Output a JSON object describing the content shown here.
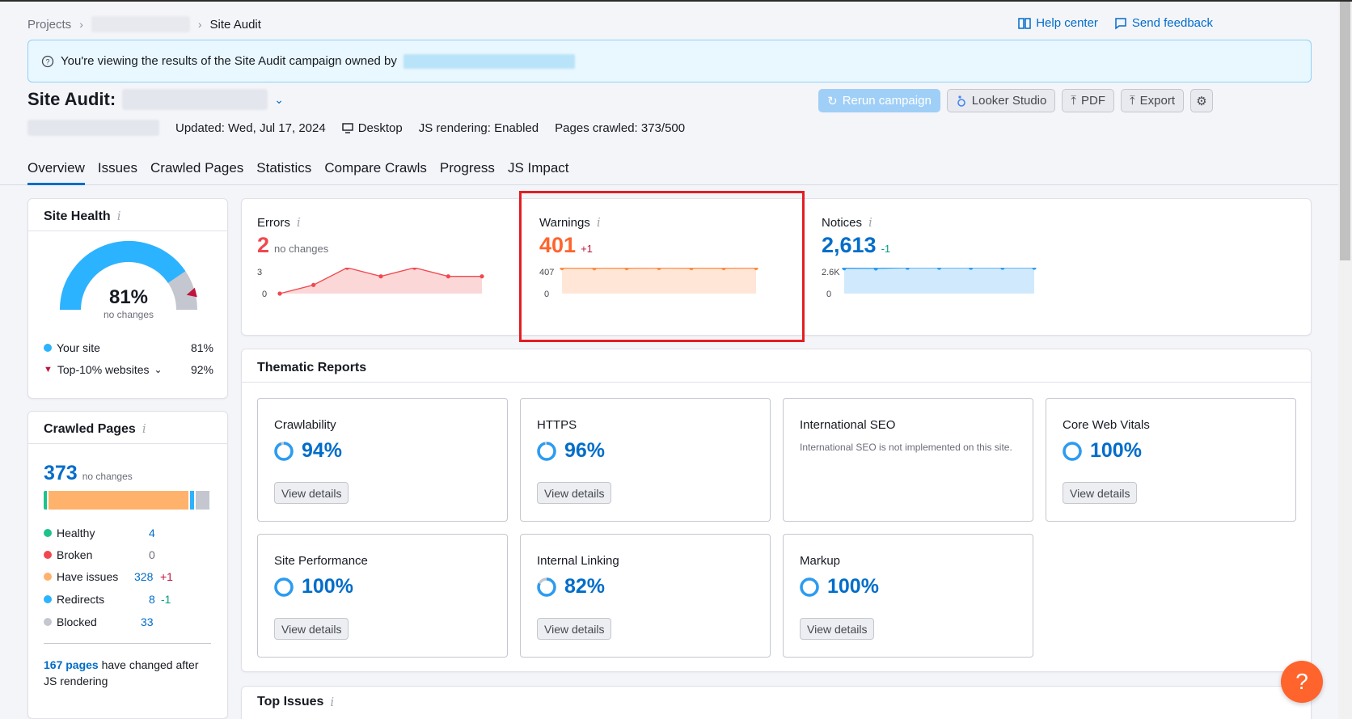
{
  "breadcrumb": {
    "projects": "Projects",
    "current": "Site Audit"
  },
  "top_links": {
    "help": "Help center",
    "feedback": "Send feedback"
  },
  "banner": {
    "text": "You're viewing the results of the Site Audit campaign owned by"
  },
  "title": {
    "label": "Site Audit:"
  },
  "actions": {
    "rerun": "Rerun campaign",
    "looker": "Looker Studio",
    "pdf": "PDF",
    "export": "Export"
  },
  "meta": {
    "updated": "Updated: Wed, Jul 17, 2024",
    "device": "Desktop",
    "js": "JS rendering: Enabled",
    "pages": "Pages crawled: 373/500"
  },
  "tabs": [
    "Overview",
    "Issues",
    "Crawled Pages",
    "Statistics",
    "Compare Crawls",
    "Progress",
    "JS Impact"
  ],
  "site_health": {
    "title": "Site Health",
    "value": "81%",
    "sub": "no changes",
    "fraction": 0.81,
    "top10_fraction": 0.92,
    "legend": [
      {
        "label": "Your site",
        "value": "81%",
        "color": "#2bb3ff"
      },
      {
        "label": "Top-10% websites",
        "value": "92%",
        "color": "#c0143c"
      }
    ]
  },
  "crawled_pages": {
    "title": "Crawled Pages",
    "total": "373",
    "sub": "no changes",
    "rows": [
      {
        "label": "Healthy",
        "num": "4",
        "delta": "",
        "color": "#1ec38a"
      },
      {
        "label": "Broken",
        "num": "0",
        "delta": "",
        "color": "#f0484f"
      },
      {
        "label": "Have issues",
        "num": "328",
        "delta": "+1",
        "color": "#ffb26b"
      },
      {
        "label": "Redirects",
        "num": "8",
        "delta": "-1",
        "color": "#2bb3ff"
      },
      {
        "label": "Blocked",
        "num": "33",
        "delta": "",
        "color": "#c4c7cf"
      }
    ],
    "note_link": "167 pages",
    "note_text": "have changed after JS rendering"
  },
  "stats": {
    "errors": {
      "label": "Errors",
      "value": "2",
      "delta": "no changes",
      "color": "#f0484f",
      "ymax_label": "3",
      "ymin_label": "0"
    },
    "warnings": {
      "label": "Warnings",
      "value": "401",
      "delta": "+1",
      "color": "#ff8c43",
      "ymax_label": "407",
      "ymin_label": "0"
    },
    "notices": {
      "label": "Notices",
      "value": "2,613",
      "delta": "-1",
      "color": "#2b9cf2",
      "ymax_label": "2.6K",
      "ymin_label": "0"
    }
  },
  "chart_data": [
    {
      "type": "area",
      "name": "Errors",
      "values": [
        0,
        1,
        3,
        2,
        3,
        2,
        2
      ],
      "ylim": [
        0,
        3
      ]
    },
    {
      "type": "area",
      "name": "Warnings",
      "values": [
        400,
        399,
        400,
        401,
        400,
        400,
        401
      ],
      "ylim": [
        0,
        407
      ]
    },
    {
      "type": "area",
      "name": "Notices",
      "values": [
        2550,
        2530,
        2610,
        2612,
        2613,
        2614,
        2613
      ],
      "ylim": [
        0,
        2600
      ]
    }
  ],
  "thematic": {
    "title": "Thematic Reports",
    "view_label": "View details",
    "reports": [
      {
        "name": "Crawlability",
        "pct": "94%",
        "fraction": 0.94
      },
      {
        "name": "HTTPS",
        "pct": "96%",
        "fraction": 0.96
      },
      {
        "name": "International SEO",
        "desc": "International SEO is not implemented on this site."
      },
      {
        "name": "Core Web Vitals",
        "pct": "100%",
        "fraction": 1.0
      },
      {
        "name": "Site Performance",
        "pct": "100%",
        "fraction": 1.0
      },
      {
        "name": "Internal Linking",
        "pct": "82%",
        "fraction": 0.82
      },
      {
        "name": "Markup",
        "pct": "100%",
        "fraction": 1.0
      }
    ]
  },
  "top_issues": {
    "title": "Top Issues"
  },
  "help_fab": "?"
}
